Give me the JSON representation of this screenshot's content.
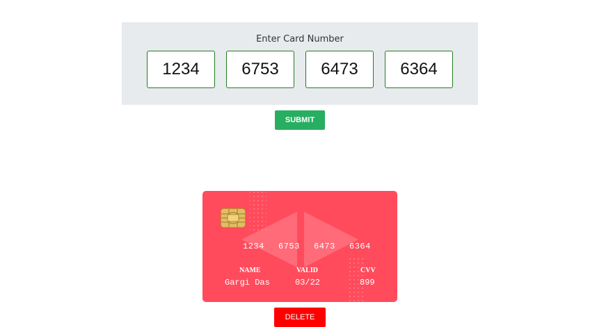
{
  "form": {
    "label": "Enter Card Number",
    "fields": [
      "1234",
      "6753",
      "6473",
      "6364"
    ],
    "submit_label": "SUBMIT"
  },
  "card": {
    "numbers": [
      "1234",
      "6753",
      "6473",
      "6364"
    ],
    "name_label": "NAME",
    "name_value": "Gargi Das",
    "valid_label": "VALID",
    "valid_value": "03/22",
    "cvv_label": "CVV",
    "cvv_value": "899",
    "icons": [
      "chip-icon"
    ]
  },
  "delete_label": "DELETE",
  "colors": {
    "panel": "#e8ebee",
    "input_border": "#1e7e1e",
    "submit": "#27ae60",
    "card": "#ff4b5c",
    "delete": "#ff0000"
  }
}
